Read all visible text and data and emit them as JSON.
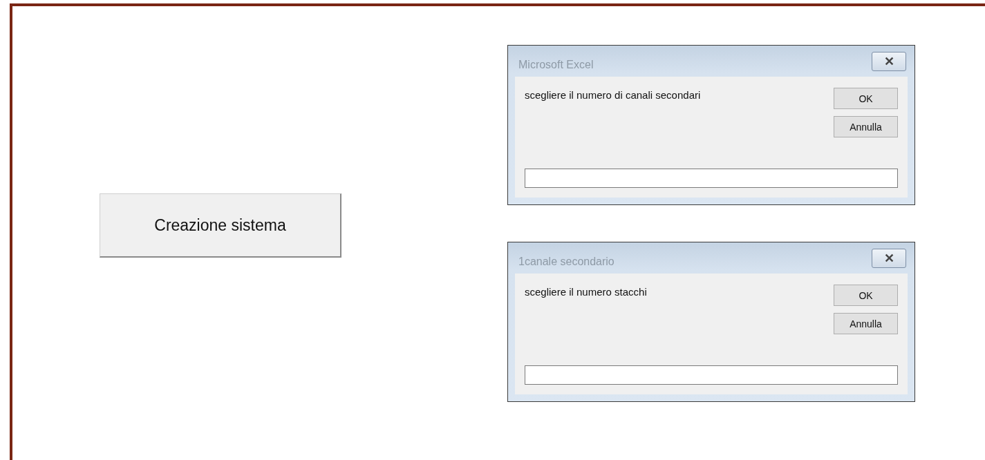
{
  "main_button": {
    "label": "Creazione sistema"
  },
  "dialogs": [
    {
      "title": "Microsoft Excel",
      "close": "✕",
      "message": "scegliere il numero di canali secondari",
      "buttons": [
        "OK",
        "Annulla"
      ]
    },
    {
      "title": "1canale secondario",
      "close": "✕",
      "message": "scegliere il numero stacchi",
      "buttons": [
        "OK",
        "Annulla"
      ]
    }
  ]
}
